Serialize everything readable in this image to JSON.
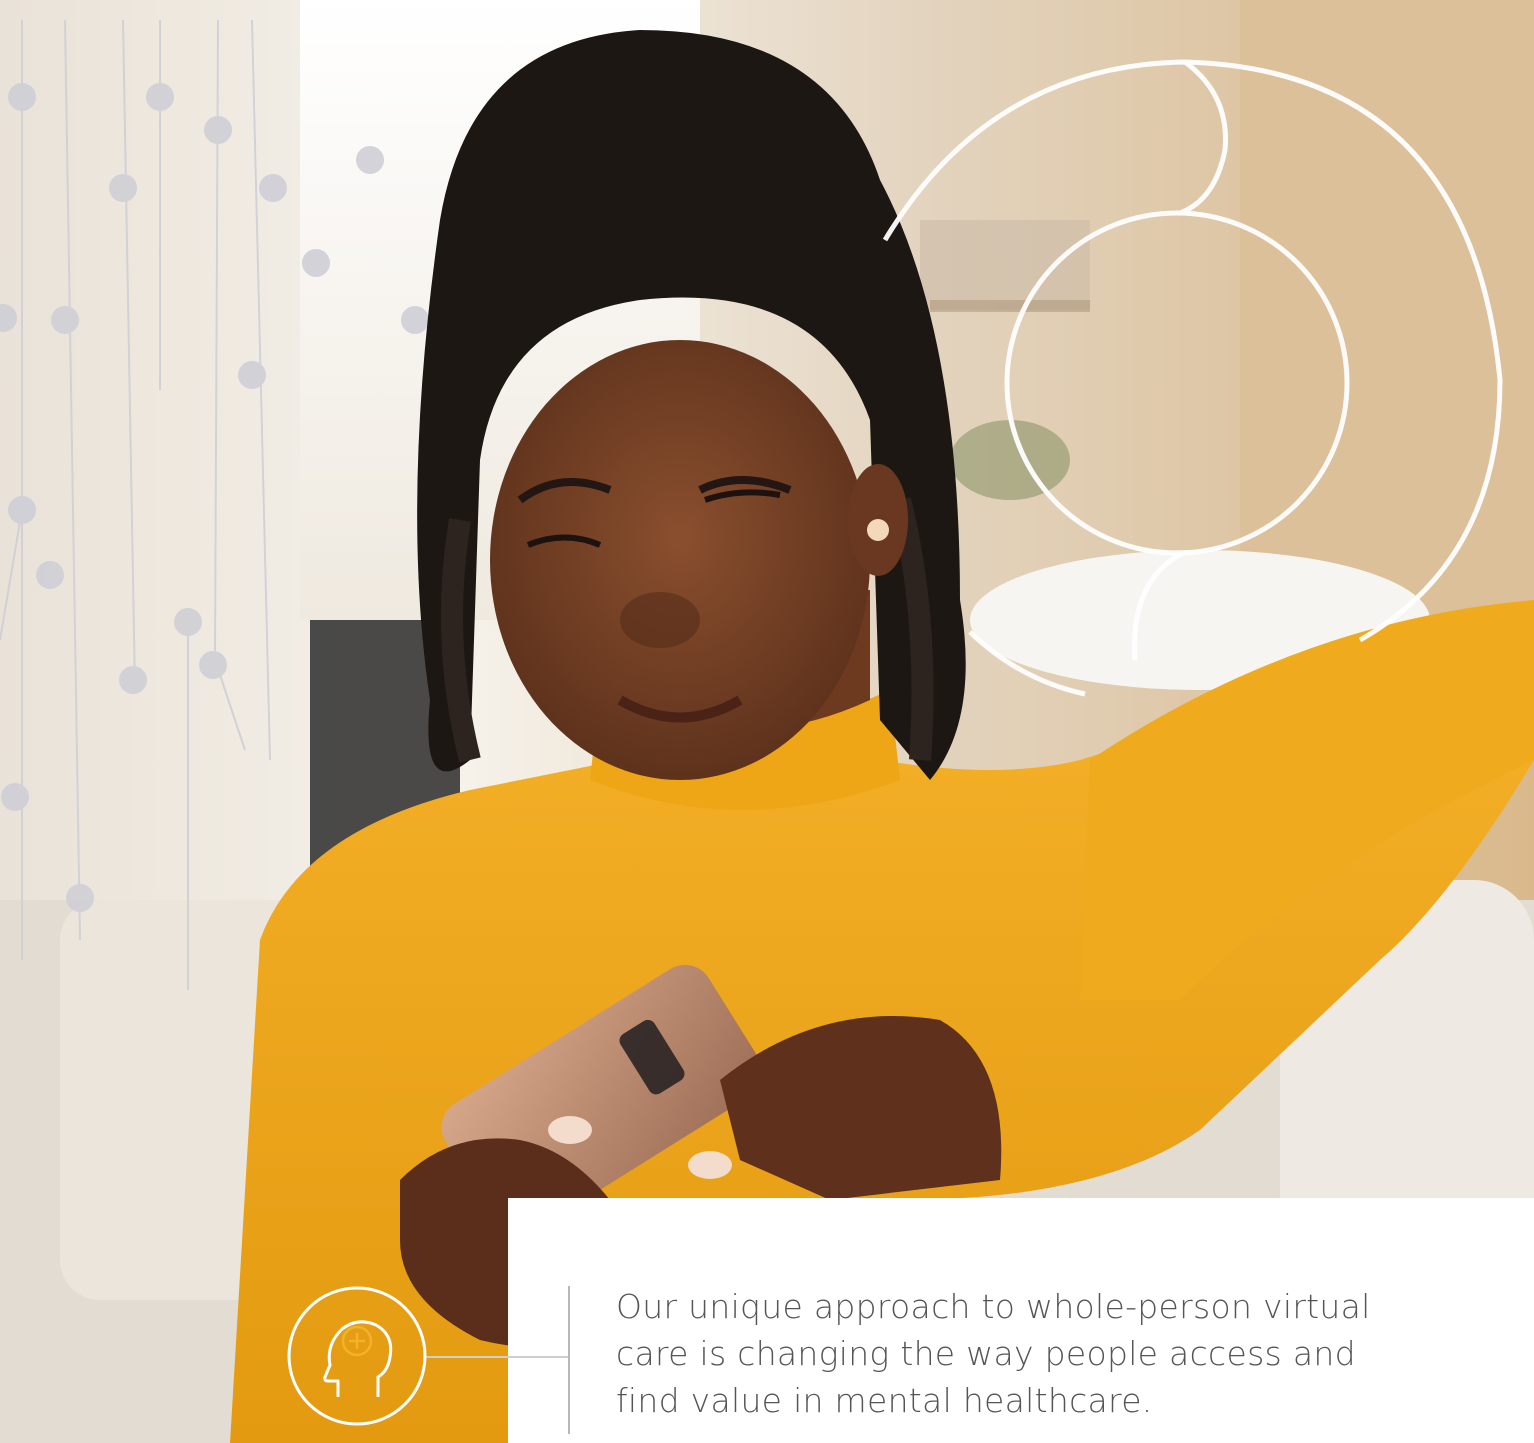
{
  "caption": {
    "line1": "Our unique approach to whole-person virtual",
    "line2": "care is changing the way people access and",
    "line3": "find value in mental healthcare."
  },
  "icons": {
    "badge": "head-plus-icon",
    "decoration": "circle-swirl-decoration"
  },
  "colors": {
    "sweater": "#f2a81d",
    "accent_gold": "#f0b32a",
    "text": "#555555",
    "divider": "#b8b8b8"
  }
}
